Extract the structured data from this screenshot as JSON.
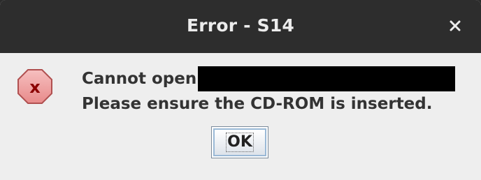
{
  "window": {
    "title": "Error - S14"
  },
  "icons": {
    "close": "close-icon",
    "error": "error-icon"
  },
  "message": {
    "line1_prefix": "Cannot open",
    "line2": "Please ensure the CD-ROM is inserted."
  },
  "buttons": {
    "ok_label": "OK"
  },
  "colors": {
    "titlebar": "#2d2d2d",
    "dialog_bg": "#eeeeee",
    "error_icon_fill": "#f0a0a0",
    "error_icon_x": "#8b0000"
  }
}
